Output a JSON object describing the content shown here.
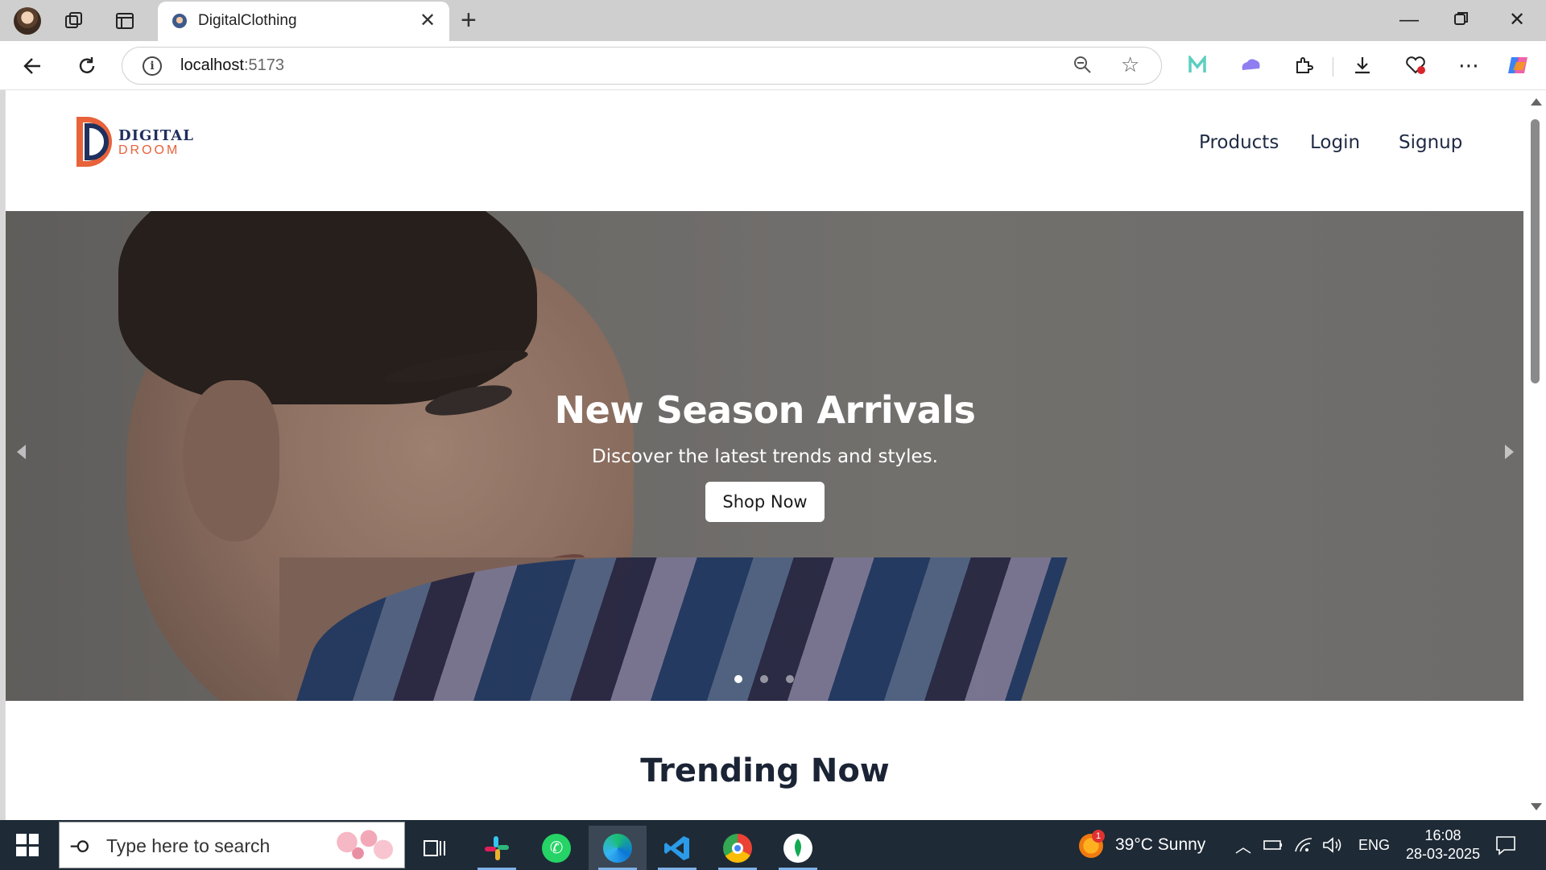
{
  "browser": {
    "tab_title": "DigitalClothing",
    "url_host": "localhost",
    "url_port": ":5173"
  },
  "site": {
    "logo_line1": "DIGITAL",
    "logo_line2": "DROOM",
    "nav": [
      "Products",
      "Login",
      "Signup"
    ]
  },
  "hero": {
    "title": "New Season Arrivals",
    "subtitle": "Discover the latest trends and styles.",
    "cta": "Shop Now",
    "slide_count": 3,
    "active_slide": 1
  },
  "section": {
    "title": "Trending Now"
  },
  "taskbar": {
    "search_placeholder": "Type here to search",
    "weather": "39°C  Sunny",
    "weather_badge": "1",
    "language": "ENG",
    "time": "16:08",
    "date": "28-03-2025"
  },
  "colors": {
    "brand_navy": "#1f2f5e",
    "brand_orange": "#e8623a",
    "taskbar": "#1e2a36"
  }
}
